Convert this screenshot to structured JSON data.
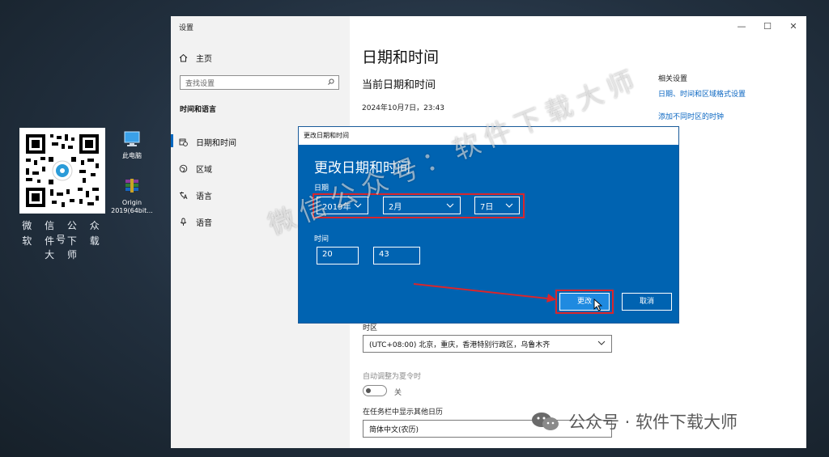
{
  "desktop": {
    "qr_caption_line1": "微 信 公 众 号",
    "qr_caption_line2": "软 件 下 载 大 师",
    "icons": [
      {
        "name": "this-pc",
        "label": "此电脑"
      },
      {
        "name": "origin",
        "label_line1": "Origin",
        "label_line2": "2019(64bit..."
      }
    ]
  },
  "settings": {
    "app_title": "设置",
    "window_controls": {
      "minimize": "—",
      "maximize": "☐",
      "close": "✕"
    },
    "sidebar": {
      "home": "主页",
      "search_placeholder": "查找设置",
      "section": "时间和语言",
      "items": [
        {
          "label": "日期和时间",
          "active": true
        },
        {
          "label": "区域"
        },
        {
          "label": "语言"
        },
        {
          "label": "语音"
        }
      ]
    },
    "main": {
      "title": "日期和时间",
      "current_heading": "当前日期和时间",
      "current_value": "2024年10月7日，23:43",
      "timezone_label": "时区",
      "timezone_value": "(UTC+08:00) 北京，重庆，香港特别行政区，乌鲁木齐",
      "dst_label": "自动调整为夏令时",
      "dst_state": "关",
      "calendar_label": "在任务栏中显示其他日历",
      "calendar_value": "简体中文(农历)"
    },
    "related": {
      "heading": "相关设置",
      "links": [
        "日期、时间和区域格式设置",
        "添加不同时区的时钟"
      ]
    }
  },
  "dialog": {
    "window_title": "更改日期和时间",
    "title": "更改日期和时间",
    "date_label": "日期",
    "year": "2019年",
    "month": "2月",
    "day": "7日",
    "time_label": "时间",
    "hour": "20",
    "minute": "43",
    "change_button": "更改",
    "cancel_button": "取消"
  },
  "watermarks": {
    "diagonal": "微信公众号：软件下载大师",
    "bottom": "公众号 · 软件下载大师"
  },
  "colors": {
    "accent": "#0063b1",
    "highlight": "#d9262c",
    "link": "#0a66c2"
  }
}
